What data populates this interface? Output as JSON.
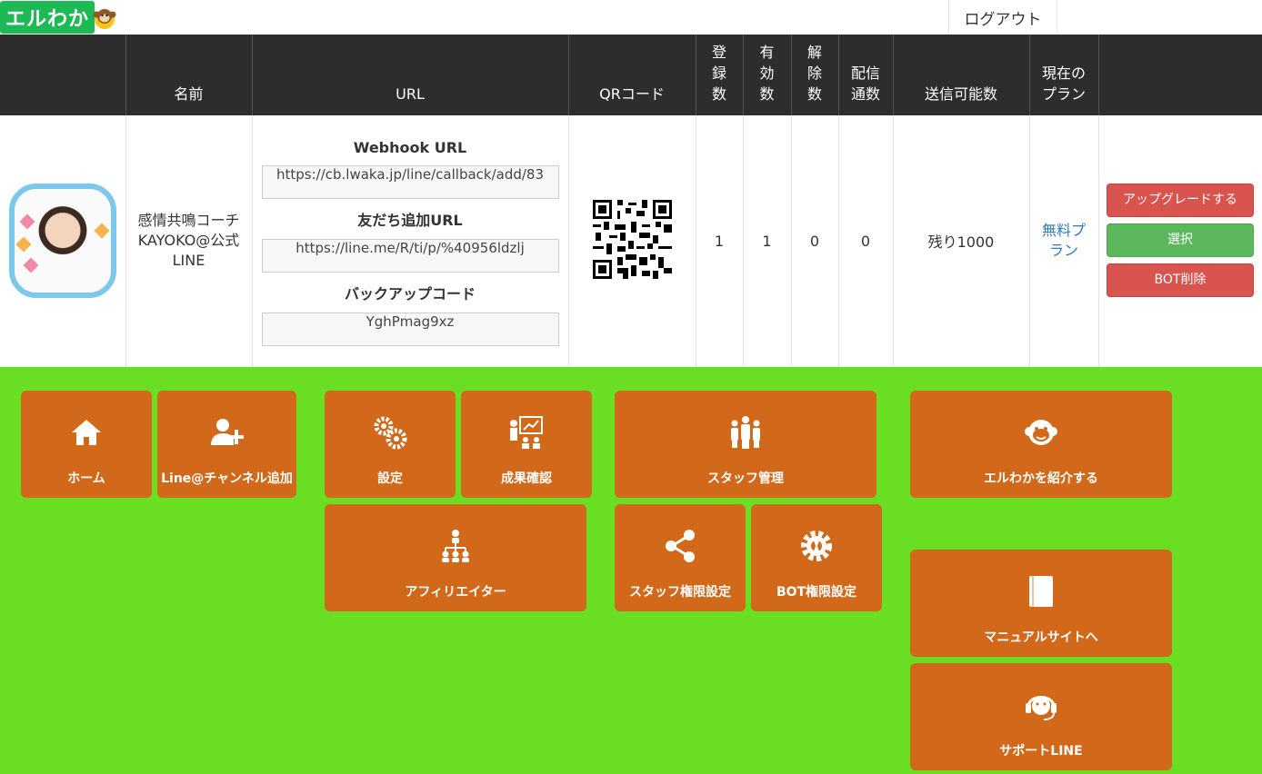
{
  "header": {
    "logo_text": "エルわか",
    "logout_label": "ログアウト"
  },
  "table": {
    "columns": {
      "name": "名前",
      "url": "URL",
      "qr": "QRコード",
      "registered": "登録数",
      "valid": "有効数",
      "cancelled": "解除数",
      "deliveries": "配信通数",
      "sendable": "送信可能数",
      "plan": "現在のプラン"
    },
    "row": {
      "bot_name_line1": "感情共鳴コーチ",
      "bot_name_line2": "KAYOKO@公式",
      "bot_name_line3": "LINE",
      "webhook_label": "Webhook URL",
      "webhook_value": "https://cb.lwaka.jp/line/callback/add/83",
      "friend_label": "友だち追加URL",
      "friend_value": "https://line.me/R/ti/p/%40956ldzlj",
      "backup_label": "バックアップコード",
      "backup_value": "YghPmag9xz",
      "registered": "1",
      "valid": "1",
      "cancelled": "0",
      "deliveries": "0",
      "sendable": "残り1000",
      "plan": "無料プラン",
      "upgrade_label": "アップグレードする",
      "select_label": "選択",
      "delete_label": "BOT削除"
    }
  },
  "menu": {
    "home": "ホーム",
    "add_channel": "Line@チャンネル追加",
    "settings": "設定",
    "results": "成果確認",
    "staff": "スタッフ管理",
    "introduce": "エルわかを紹介する",
    "affiliator": "アフィリエイター",
    "staff_permissions": "スタッフ権限設定",
    "bot_permissions": "BOT権限設定",
    "manual": "マニュアルサイトへ",
    "support": "サポートLINE"
  },
  "colors": {
    "header_bg": "#2d2d2d",
    "menu_bg": "#6ade22",
    "tile_bg": "#d2691a",
    "danger": "#d9534f",
    "success": "#5cb85c",
    "link": "#337ab7"
  },
  "icons": [
    "home-icon",
    "add-user-icon",
    "gears-icon",
    "presentation-icon",
    "staff-group-icon",
    "monkey-icon",
    "hierarchy-icon",
    "share-icon",
    "gear-wrench-icon",
    "book-icon",
    "headset-icon"
  ]
}
